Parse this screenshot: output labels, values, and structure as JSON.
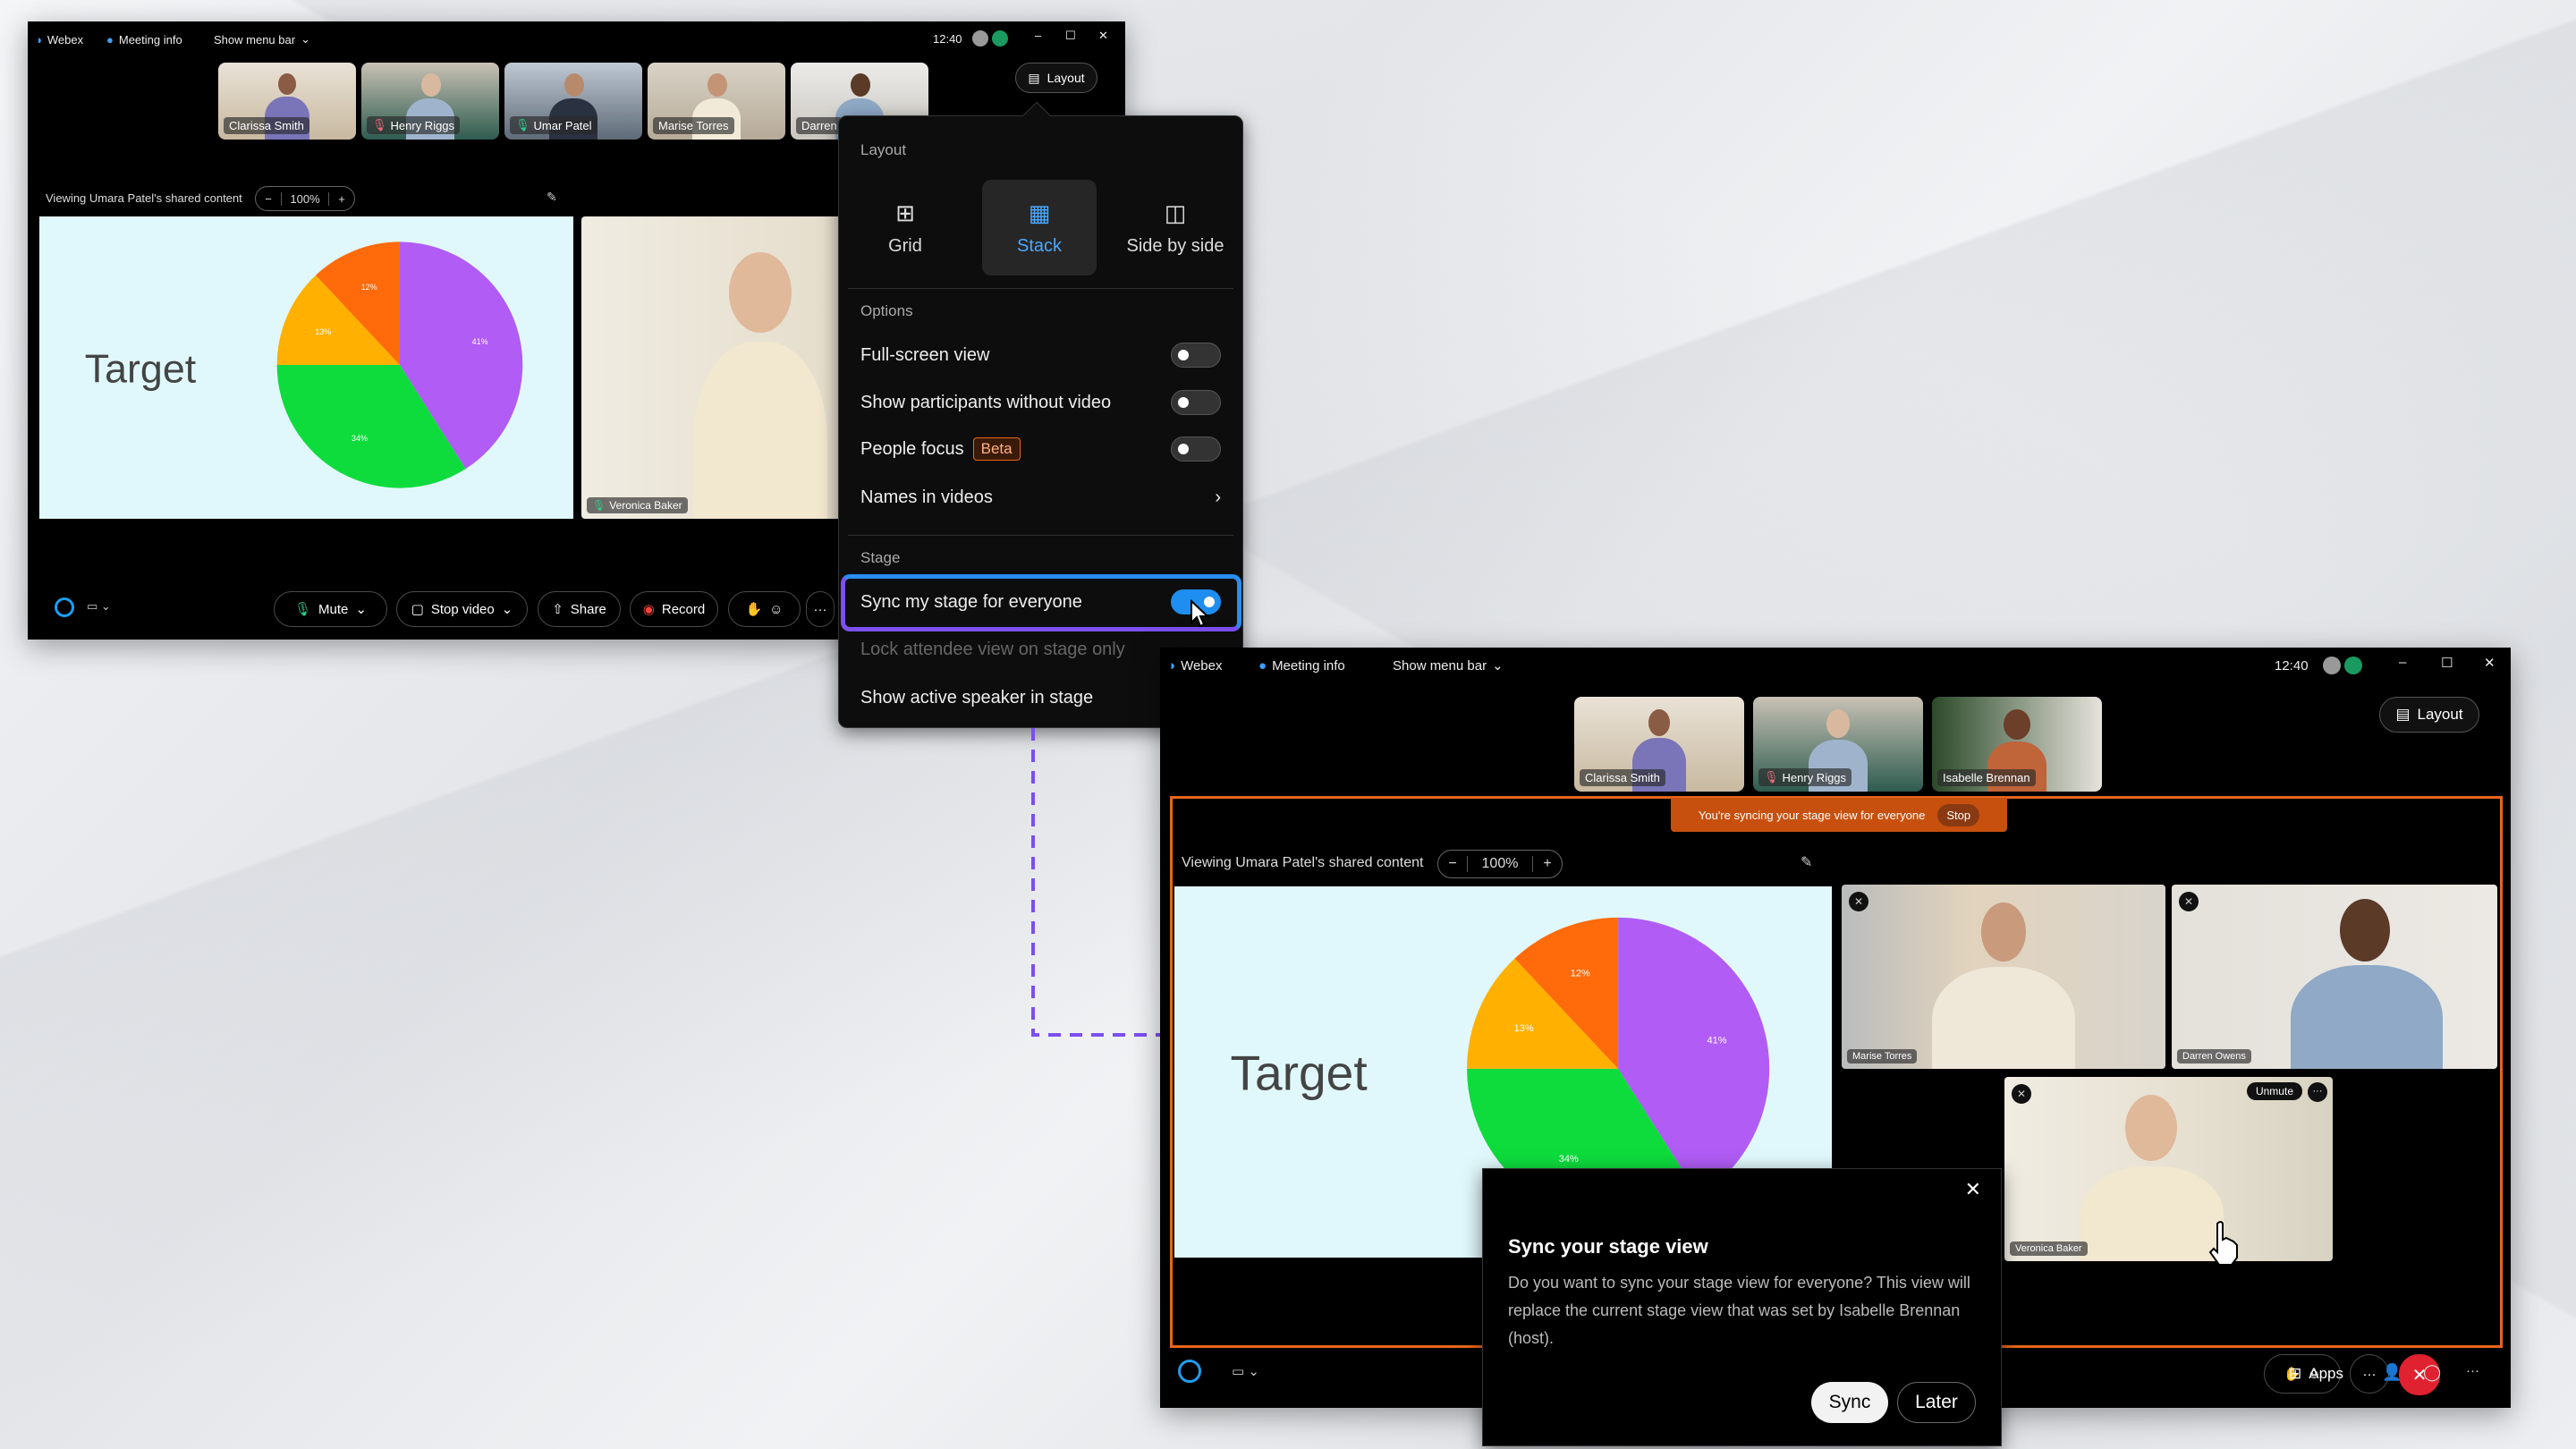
{
  "window1": {
    "title_bar": {
      "app": "Webex",
      "meeting_info": "Meeting info",
      "menu_bar": "Show menu bar",
      "time": "12:40"
    },
    "layout_button": "Layout",
    "participants": [
      "Clarissa Smith",
      "Henry Riggs",
      "Umar Patel",
      "Marise Torres",
      "Darren"
    ],
    "viewing_label": "Viewing Umara Patel's shared content",
    "zoom_level": "100%",
    "stage_video": "Veronica Baker",
    "controls": {
      "mute": "Mute",
      "stop_video": "Stop video",
      "share": "Share",
      "record": "Record",
      "more": "···"
    }
  },
  "slide": {
    "title": "Target",
    "pie": [
      {
        "label": "41%",
        "value": 41,
        "color": "#b05cf5"
      },
      {
        "label": "34%",
        "value": 34,
        "color": "#0ddc3c"
      },
      {
        "label": "13%",
        "value": 13,
        "color": "#ffb000"
      },
      {
        "label": "12%",
        "value": 12,
        "color": "#ff6a0a"
      }
    ]
  },
  "layout_menu": {
    "layout_heading": "Layout",
    "layouts": [
      {
        "label": "Grid",
        "selected": false
      },
      {
        "label": "Stack",
        "selected": true
      },
      {
        "label": "Side by side",
        "selected": false
      }
    ],
    "options_heading": "Options",
    "options": [
      {
        "label": "Full-screen view",
        "on": false
      },
      {
        "label": "Show participants without video",
        "on": false
      },
      {
        "label": "People focus",
        "badge": "Beta",
        "on": false
      },
      {
        "label": "Names in videos"
      }
    ],
    "stage_heading": "Stage",
    "stage": {
      "sync": "Sync my stage for everyone",
      "sync_on": true,
      "lock": "Lock attendee view on stage only",
      "active_speaker": "Show active speaker in stage"
    }
  },
  "window2": {
    "title_bar": {
      "app": "Webex",
      "meeting_info": "Meeting info",
      "menu_bar": "Show menu bar",
      "time": "12:40"
    },
    "layout_button": "Layout",
    "participants": [
      "Clarissa Smith",
      "Henry Riggs",
      "Isabelle Brennan"
    ],
    "sync_banner": {
      "text": "You're syncing your stage view for everyone",
      "stop": "Stop"
    },
    "viewing_label": "Viewing Umara Patel's shared content",
    "zoom_level": "100%",
    "stage_videos": [
      "Marise Torres",
      "Darren Owens",
      "Veronica Baker"
    ],
    "unmute": "Unmute",
    "controls": {
      "more": "···",
      "apps": "Apps"
    }
  },
  "dialog": {
    "title": "Sync your stage view",
    "body": "Do you want to sync your stage view for everyone? This view will replace the current stage view that was set by Isabelle Brennan (host).",
    "sync": "Sync",
    "later": "Later"
  },
  "colors": {
    "accent": "#1e8ef0",
    "sync_border": "#e8651a",
    "banner": "#c8500f",
    "end_call": "#e0212f",
    "highlight": "#7b4ff0"
  }
}
